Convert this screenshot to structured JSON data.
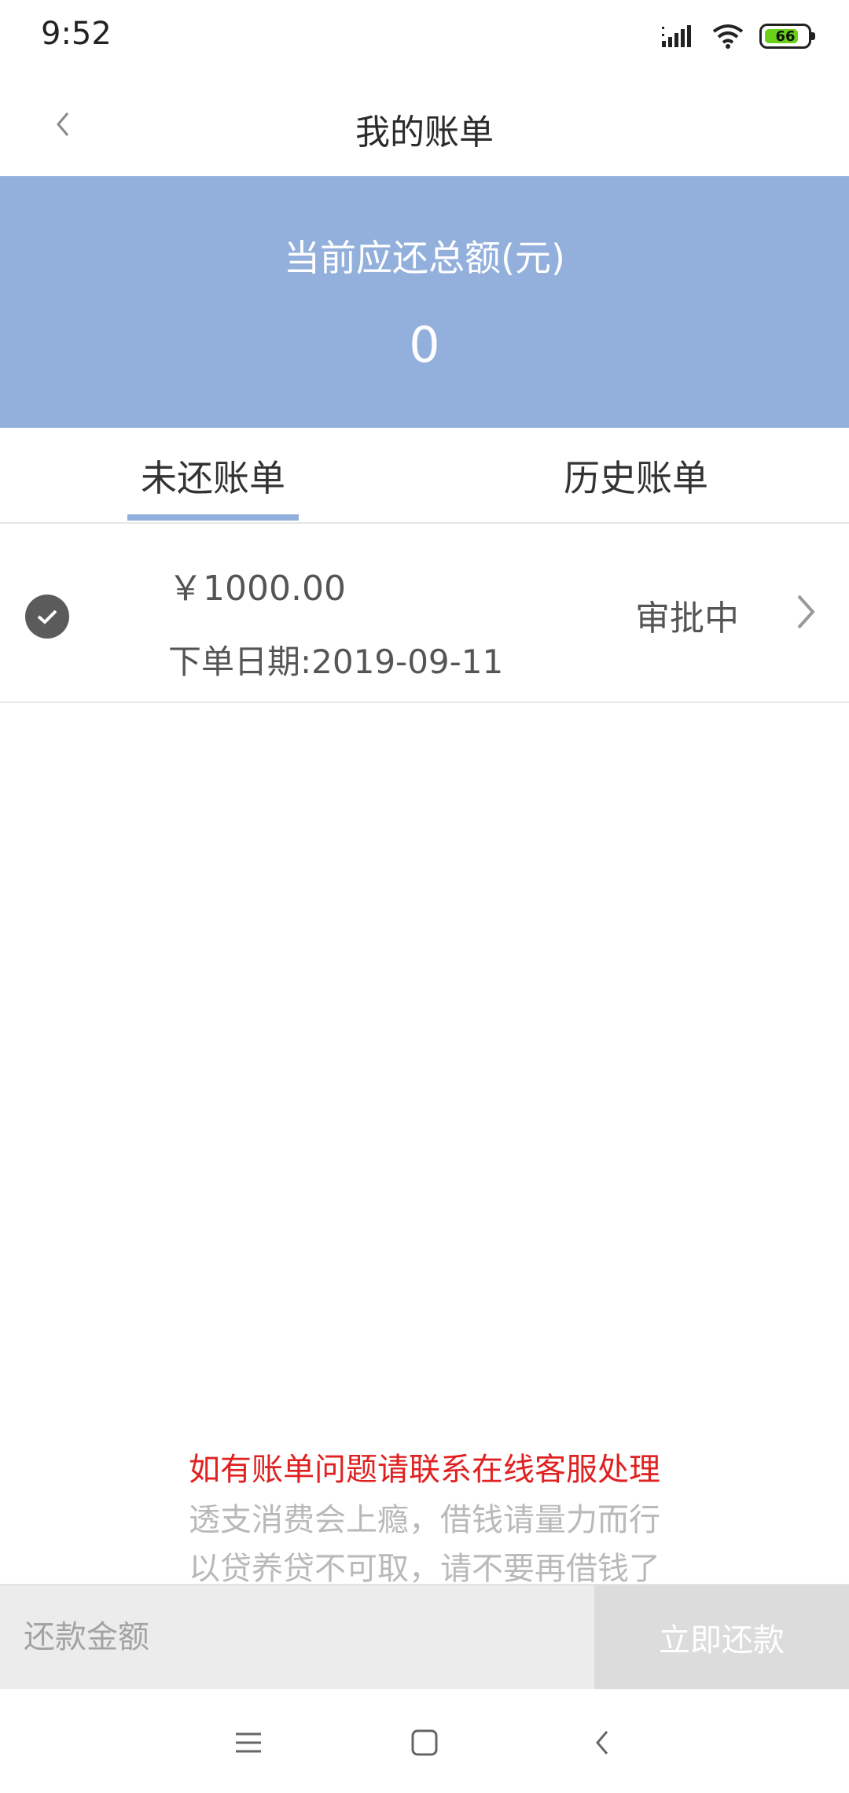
{
  "status_bar": {
    "time": "9:52",
    "battery_level": "66"
  },
  "header": {
    "title": "我的账单"
  },
  "summary": {
    "label": "当前应还总额(元)",
    "value": "0"
  },
  "tabs": [
    {
      "label": "未还账单",
      "active": true
    },
    {
      "label": "历史账单",
      "active": false
    }
  ],
  "bills": [
    {
      "amount": "￥1000.00",
      "date": "下单日期:2019-09-11",
      "status": "审批中"
    }
  ],
  "notices": {
    "contact": "如有账单问题请联系在线客服处理",
    "warning_1": "透支消费会上瘾，借钱请量力而行",
    "warning_2": "以贷养贷不可取，请不要再借钱了"
  },
  "payment": {
    "placeholder": "还款金额",
    "button_label": "立即还款"
  },
  "colors": {
    "accent": "#93b0dd",
    "notice_red": "#e02121",
    "status_green": "#6ad01a"
  },
  "icons": [
    "back-arrow-icon",
    "signal-icon",
    "wifi-icon",
    "battery-icon",
    "check-circle-icon",
    "chevron-right-icon",
    "menu-icon",
    "home-icon",
    "nav-back-icon"
  ]
}
